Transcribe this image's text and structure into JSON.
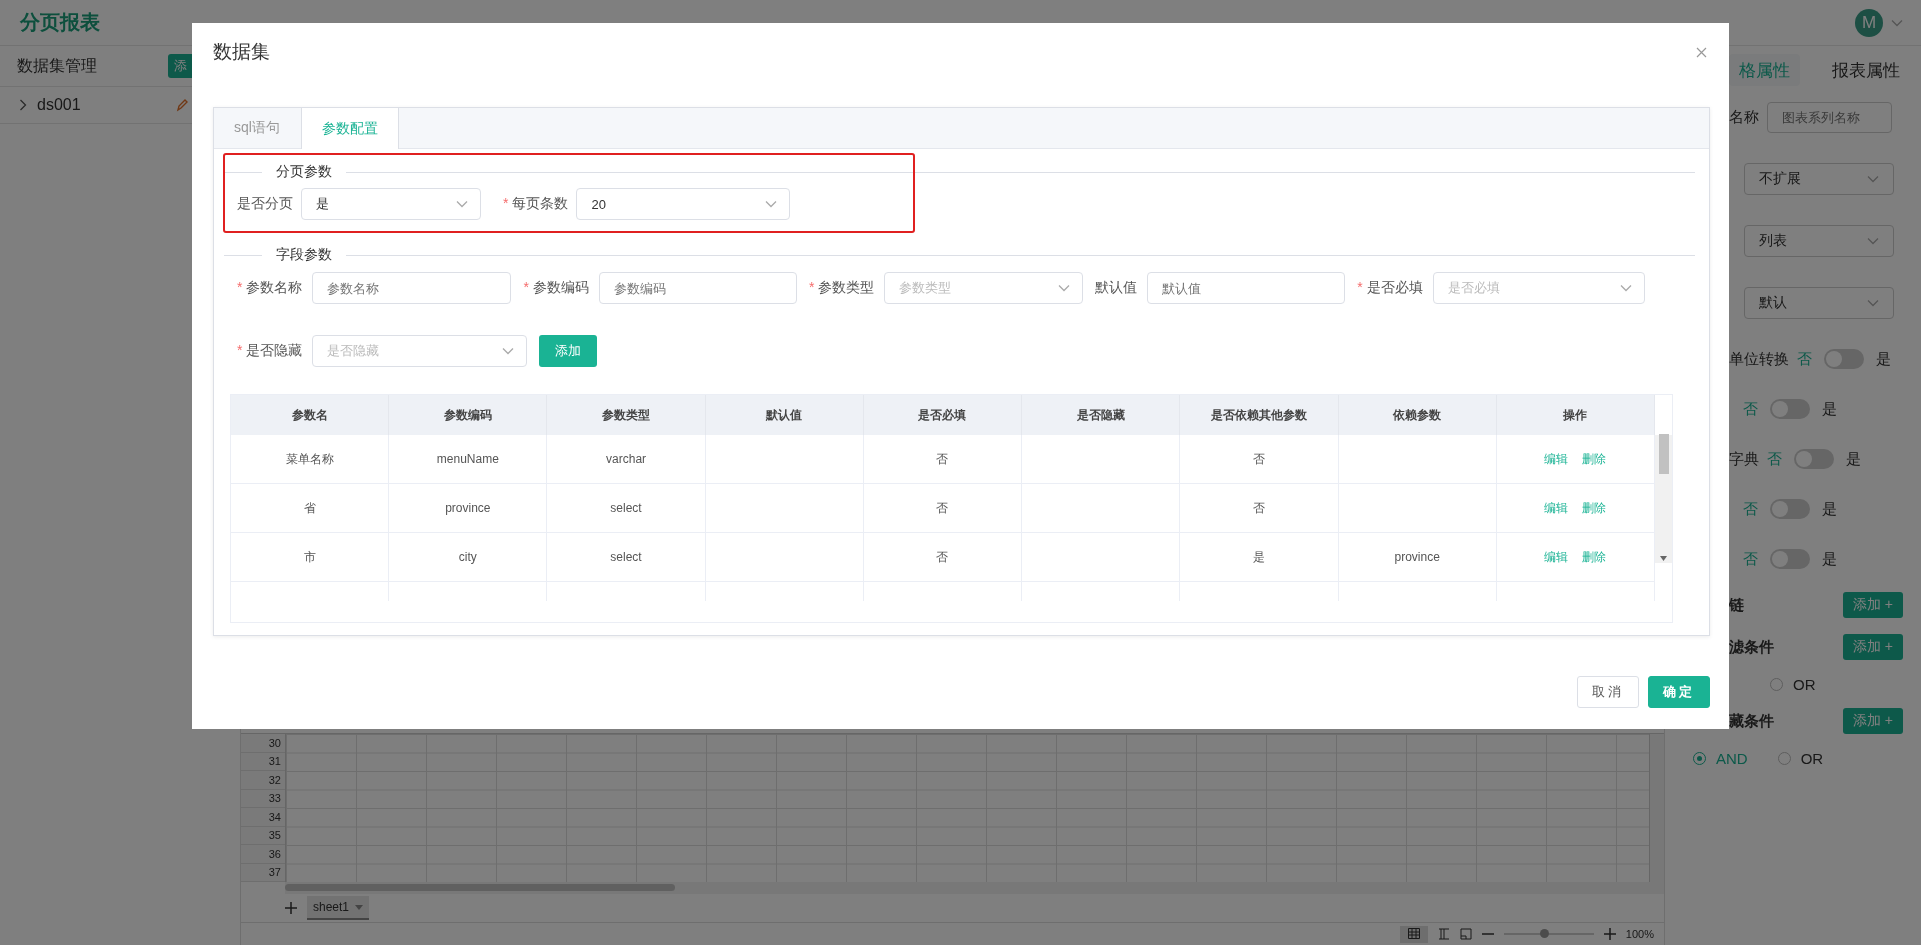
{
  "app": {
    "title": "分页报表",
    "avatar": "M"
  },
  "left_panel": {
    "title": "数据集管理",
    "add_button": "添",
    "datasets": [
      {
        "name": "ds001",
        "expanded": false
      }
    ]
  },
  "right_panel": {
    "tabs": [
      {
        "label": "格属性",
        "selected": true
      },
      {
        "label": "报表属性",
        "selected": false
      }
    ],
    "fields": [
      {
        "kind": "input",
        "label": "名称",
        "placeholder": "图表系列名称"
      },
      {
        "kind": "select",
        "value": "不扩展"
      },
      {
        "kind": "select",
        "value": "列表"
      },
      {
        "kind": "select",
        "value": "默认"
      },
      {
        "kind": "toggle",
        "label": "单位转换",
        "off_label": "否",
        "on_label": "是",
        "on": false
      },
      {
        "kind": "toggle",
        "off_label": "否",
        "on_label": "是",
        "on": false
      },
      {
        "kind": "toggle",
        "label": "字典",
        "off_label": "否",
        "on_label": "是",
        "on": false
      },
      {
        "kind": "toggle",
        "off_label": "否",
        "on_label": "是",
        "on": false
      },
      {
        "kind": "toggle",
        "off_label": "否",
        "on_label": "是",
        "on": false
      },
      {
        "kind": "add",
        "label": "链",
        "button": "添加 +"
      },
      {
        "kind": "add",
        "label": "滤条件",
        "button": "添加 +"
      },
      {
        "kind": "radios",
        "options": [
          {
            "label": "OR",
            "selected": false
          }
        ]
      },
      {
        "kind": "add",
        "label": "藏条件",
        "button": "添加 +"
      },
      {
        "kind": "radios",
        "options": [
          {
            "label": "AND",
            "selected": true
          },
          {
            "label": "OR",
            "selected": false
          }
        ]
      }
    ]
  },
  "sheet": {
    "row_numbers": [
      "30",
      "31",
      "32",
      "33",
      "34",
      "35",
      "36",
      "37"
    ],
    "tabs": [
      {
        "label": "sheet1",
        "selected": true
      }
    ],
    "zoom_slider": {
      "level": 0.45
    },
    "zoom": "100%"
  },
  "dialog": {
    "title": "数据集",
    "tabs": [
      {
        "label": "sql语句",
        "selected": false
      },
      {
        "label": "参数配置",
        "selected": true
      }
    ],
    "paging": {
      "title": "分页参数",
      "fields": [
        {
          "kind": "select",
          "label": "是否分页",
          "value": "是"
        },
        {
          "kind": "select",
          "required_mark": "*",
          "label": "每页条数",
          "value": "20"
        }
      ]
    },
    "field_params": {
      "title": "字段参数",
      "fields": [
        {
          "kind": "input",
          "required_mark": "*",
          "label": "参数名称",
          "placeholder": "参数名称"
        },
        {
          "kind": "input",
          "required_mark": "*",
          "label": "参数编码",
          "placeholder": "参数编码"
        },
        {
          "kind": "select",
          "required_mark": "*",
          "label": "参数类型",
          "placeholder": "参数类型"
        },
        {
          "kind": "input",
          "label": "默认值",
          "placeholder": "默认值"
        },
        {
          "kind": "select",
          "required_mark": "*",
          "label": "是否必填",
          "placeholder": "是否必填"
        },
        {
          "kind": "select",
          "required_mark": "*",
          "label": "是否隐藏",
          "placeholder": "是否隐藏"
        }
      ],
      "add_button": "添加"
    },
    "table": {
      "columns": [
        "参数名",
        "参数编码",
        "参数类型",
        "默认值",
        "是否必填",
        "是否隐藏",
        "是否依赖其他参数",
        "依赖参数",
        "操作"
      ],
      "rows": [
        {
          "cells": [
            "菜单名称",
            "menuName",
            "varchar",
            null,
            "否",
            null,
            "否",
            null
          ],
          "actions": [
            "编辑",
            "删除"
          ]
        },
        {
          "cells": [
            "省",
            "province",
            "select",
            null,
            "否",
            null,
            "否",
            null
          ],
          "actions": [
            "编辑",
            "删除"
          ]
        },
        {
          "cells": [
            "市",
            "city",
            "select",
            null,
            "否",
            null,
            "是",
            "province"
          ],
          "actions": [
            "编辑",
            "删除"
          ]
        }
      ]
    },
    "buttons": [
      {
        "kind": "secondary",
        "label": "取消"
      },
      {
        "kind": "primary",
        "label": "确定"
      }
    ]
  }
}
